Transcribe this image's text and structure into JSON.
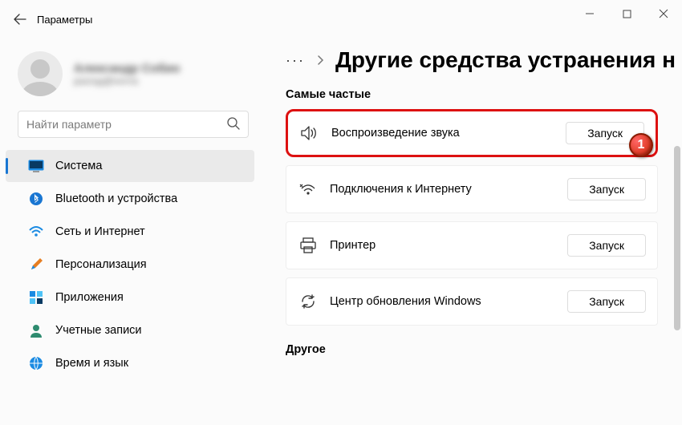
{
  "window": {
    "title": "Параметры"
  },
  "profile": {
    "name": "Александр Собин",
    "email": "разгад@почта"
  },
  "search": {
    "placeholder": "Найти параметр"
  },
  "sidebar": {
    "items": [
      {
        "label": "Система",
        "icon": "monitor",
        "selected": true
      },
      {
        "label": "Bluetooth и устройства",
        "icon": "bluetooth"
      },
      {
        "label": "Сеть и Интернет",
        "icon": "wifi"
      },
      {
        "label": "Персонализация",
        "icon": "brush"
      },
      {
        "label": "Приложения",
        "icon": "apps"
      },
      {
        "label": "Учетные записи",
        "icon": "person"
      },
      {
        "label": "Время и язык",
        "icon": "globe"
      }
    ]
  },
  "breadcrumb": {
    "more": "···",
    "title": "Другие средства устранения н"
  },
  "sections": {
    "frequent": "Самые частые",
    "other": "Другое"
  },
  "troubleshooters": [
    {
      "label": "Воспроизведение звука",
      "icon": "sound",
      "action": "Запуск",
      "highlight": true
    },
    {
      "label": "Подключения к Интернету",
      "icon": "netwifi",
      "action": "Запуск"
    },
    {
      "label": "Принтер",
      "icon": "printer",
      "action": "Запуск"
    },
    {
      "label": "Центр обновления Windows",
      "icon": "refresh",
      "action": "Запуск"
    }
  ],
  "annotation": {
    "badge": "1"
  }
}
